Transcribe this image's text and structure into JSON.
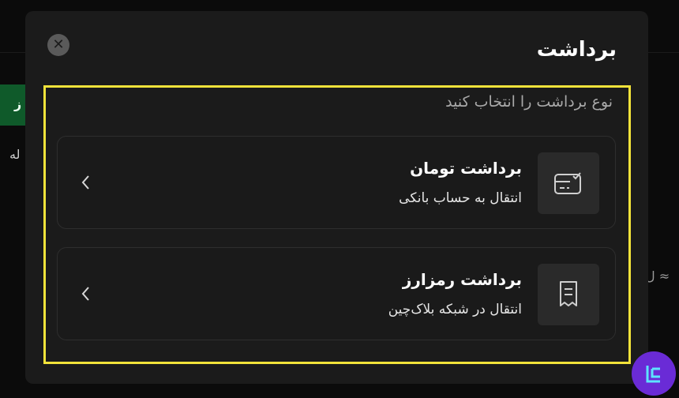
{
  "background": {
    "green_label": "ز",
    "left_text": "له",
    "right_text": "ل ≈"
  },
  "modal": {
    "title": "برداشت",
    "close_symbol": "✕",
    "subtitle": "نوع برداشت را انتخاب کنید",
    "options": [
      {
        "title": "برداشت تومان",
        "description": "انتقال به حساب بانکی",
        "icon": "bank-card-check-icon"
      },
      {
        "title": "برداشت رمزارز",
        "description": "انتقال در شبکه بلاک‌چین",
        "icon": "receipt-icon"
      }
    ]
  },
  "colors": {
    "modal_bg": "#1b1b1b",
    "highlight": "#f2e33a",
    "accent_logo": "#6a2bd6"
  }
}
